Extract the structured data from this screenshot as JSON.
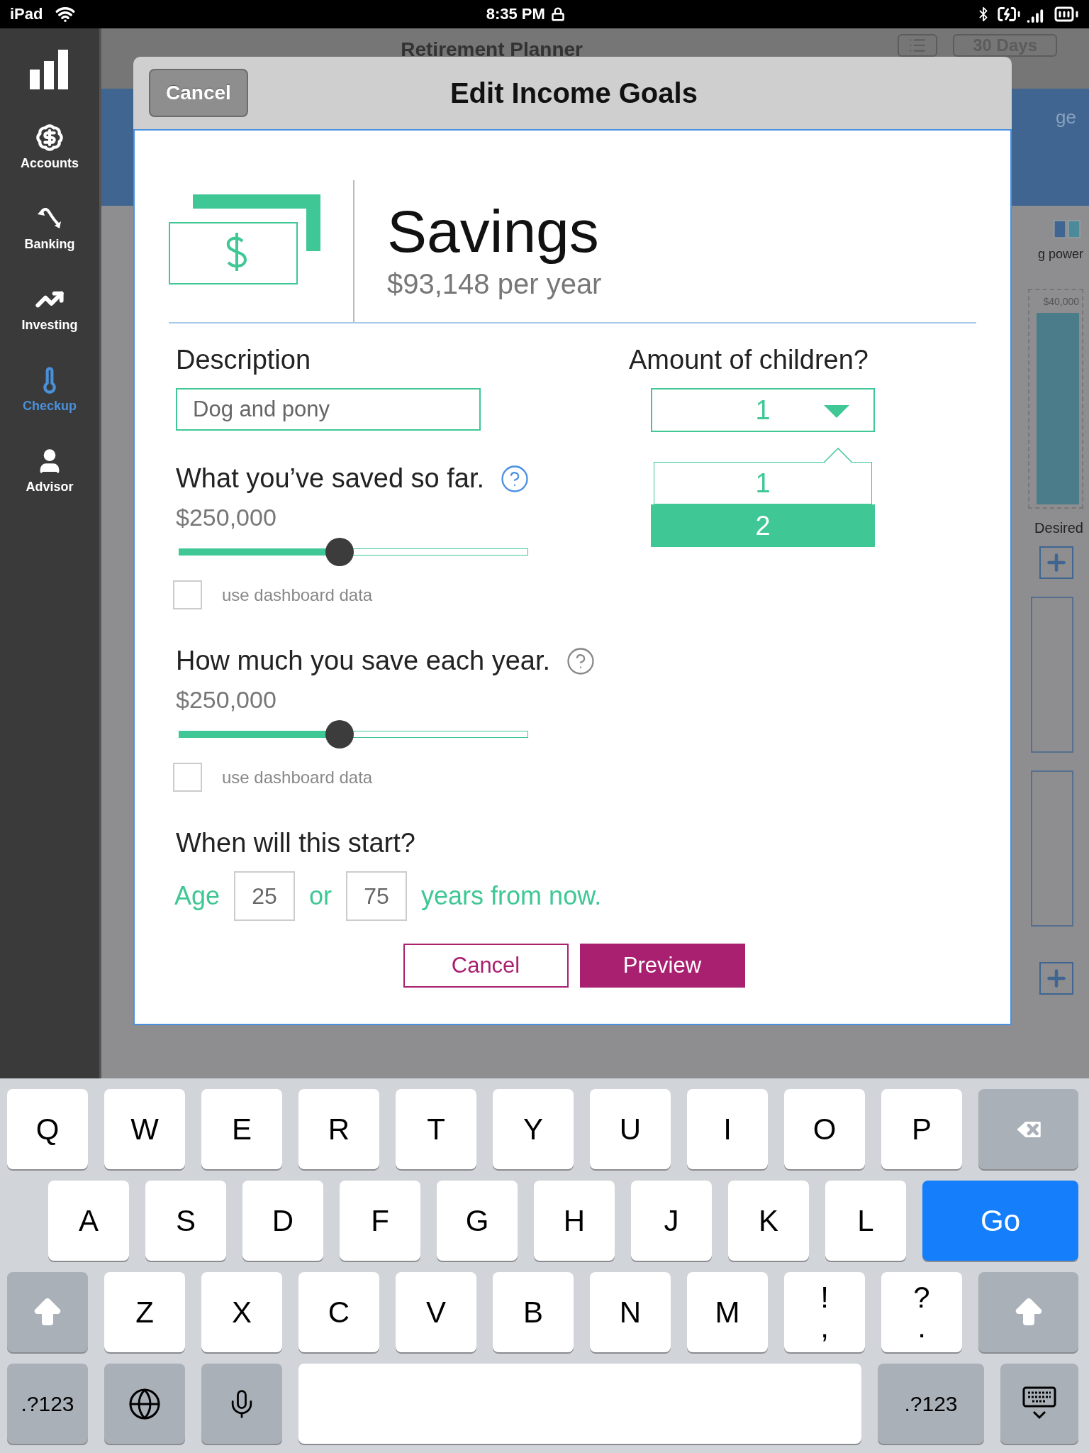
{
  "status_bar": {
    "device": "iPad",
    "time": "8:35 PM"
  },
  "sidebar": {
    "items": [
      {
        "kind": "accounts",
        "label": "Accounts",
        "selected": false
      },
      {
        "kind": "banking",
        "label": "Banking",
        "selected": false
      },
      {
        "kind": "investing",
        "label": "Investing",
        "selected": false
      },
      {
        "kind": "checkup",
        "label": "Checkup",
        "selected": true
      },
      {
        "kind": "advisor",
        "label": "Advisor",
        "selected": false
      }
    ]
  },
  "background": {
    "title": "Retirement Planner",
    "range_button": "30 Days",
    "tab_fragment": "ge",
    "legend_fragment": "g power",
    "chart_label": "$40,000",
    "column_label": "Desired"
  },
  "dialog": {
    "title": "Edit Income Goals",
    "cancel": "Cancel",
    "goal": {
      "name": "Savings",
      "amount": "$93,148 per year"
    },
    "description": {
      "label": "Description",
      "value": "Dog and pony"
    },
    "sliders": [
      {
        "label": "What you’ve saved so far.",
        "value": "$250,000",
        "level": 0.46,
        "active": true,
        "checkbox_label": "use dashboard data",
        "checked": false
      },
      {
        "label": "How much you save each year.",
        "value": "$250,000",
        "level": 0.46,
        "active": false,
        "checkbox_label": "use dashboard data",
        "checked": false
      }
    ],
    "start": {
      "label": "When will this start?",
      "age_label": "Age",
      "age": "25",
      "or": "or",
      "years": "75",
      "years_label": "years from now."
    },
    "children": {
      "label": "Amount of children?",
      "value": "1",
      "options": [
        {
          "label": "1",
          "highlighted": false
        },
        {
          "label": "2",
          "highlighted": true
        }
      ]
    },
    "buttons": {
      "cancel": "Cancel",
      "preview": "Preview"
    }
  },
  "keyboard": {
    "rows": [
      {
        "keys": [
          {
            "kind": "char",
            "label": "Q"
          },
          {
            "kind": "char",
            "label": "W"
          },
          {
            "kind": "char",
            "label": "E"
          },
          {
            "kind": "char",
            "label": "R"
          },
          {
            "kind": "char",
            "label": "T"
          },
          {
            "kind": "char",
            "label": "Y"
          },
          {
            "kind": "char",
            "label": "U"
          },
          {
            "kind": "char",
            "label": "I"
          },
          {
            "kind": "char",
            "label": "O"
          },
          {
            "kind": "char",
            "label": "P"
          },
          {
            "kind": "backspace"
          }
        ]
      },
      {
        "keys": [
          {
            "kind": "char",
            "label": "A"
          },
          {
            "kind": "char",
            "label": "S"
          },
          {
            "kind": "char",
            "label": "D"
          },
          {
            "kind": "char",
            "label": "F"
          },
          {
            "kind": "char",
            "label": "G"
          },
          {
            "kind": "char",
            "label": "H"
          },
          {
            "kind": "char",
            "label": "J"
          },
          {
            "kind": "char",
            "label": "K"
          },
          {
            "kind": "char",
            "label": "L"
          },
          {
            "kind": "go",
            "label": "Go"
          }
        ]
      },
      {
        "keys": [
          {
            "kind": "shift"
          },
          {
            "kind": "char",
            "label": "Z"
          },
          {
            "kind": "char",
            "label": "X"
          },
          {
            "kind": "char",
            "label": "C"
          },
          {
            "kind": "char",
            "label": "V"
          },
          {
            "kind": "char",
            "label": "B"
          },
          {
            "kind": "char",
            "label": "N"
          },
          {
            "kind": "char",
            "label": "M"
          },
          {
            "kind": "punct",
            "label": "!",
            "alt": ","
          },
          {
            "kind": "punct",
            "label": "?",
            "alt": "."
          },
          {
            "kind": "shift"
          }
        ]
      },
      {
        "keys": [
          {
            "kind": "mode",
            "label": ".?123"
          },
          {
            "kind": "globe"
          },
          {
            "kind": "mic"
          },
          {
            "kind": "space"
          },
          {
            "kind": "mode",
            "label": ".?123"
          },
          {
            "kind": "hide"
          }
        ]
      }
    ]
  }
}
